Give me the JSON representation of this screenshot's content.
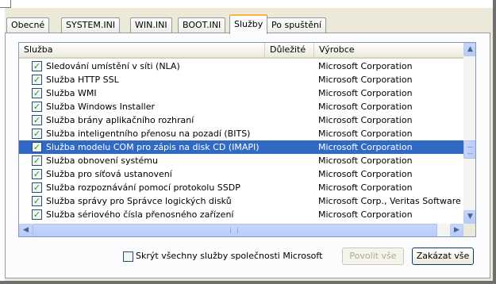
{
  "tabs": [
    "Obecné",
    "SYSTEM.INI",
    "WIN.INI",
    "BOOT.INI",
    "Služby",
    "Po spuštění"
  ],
  "active_tab": "Služby",
  "list": {
    "columns": {
      "service": "Služba",
      "essential": "Důležité",
      "manufacturer": "Výrobce"
    },
    "rows": [
      {
        "name": "Sledování umístění v síti (NLA)",
        "vendor": "Microsoft Corporation",
        "checked": true,
        "selected": false
      },
      {
        "name": "Služba HTTP SSL",
        "vendor": "Microsoft Corporation",
        "checked": true,
        "selected": false
      },
      {
        "name": "Služba WMI",
        "vendor": "Microsoft Corporation",
        "checked": true,
        "selected": false
      },
      {
        "name": "Služba Windows Installer",
        "vendor": "Microsoft Corporation",
        "checked": true,
        "selected": false
      },
      {
        "name": "Služba brány aplikačního rozhraní",
        "vendor": "Microsoft Corporation",
        "checked": true,
        "selected": false
      },
      {
        "name": "Služba inteligentního přenosu na pozadí (BITS)",
        "vendor": "Microsoft Corporation",
        "checked": true,
        "selected": false
      },
      {
        "name": "Služba modelu COM pro zápis na disk CD (IMAPI)",
        "vendor": "Microsoft Corporation",
        "checked": true,
        "selected": true
      },
      {
        "name": "Služba obnovení systému",
        "vendor": "Microsoft Corporation",
        "checked": true,
        "selected": false
      },
      {
        "name": "Služba pro síťová ustanovení",
        "vendor": "Microsoft Corporation",
        "checked": true,
        "selected": false
      },
      {
        "name": "Služba rozpoznávání pomocí protokolu SSDP",
        "vendor": "Microsoft Corporation",
        "checked": true,
        "selected": false
      },
      {
        "name": "Služba správy pro Správce logických disků",
        "vendor": "Microsoft Corp., Veritas Software",
        "checked": true,
        "selected": false
      },
      {
        "name": "Služba sériového čísla přenosného zařízení",
        "vendor": "Microsoft Corporation",
        "checked": true,
        "selected": false
      }
    ]
  },
  "hide_ms_label": "Skrýt všechny služby společnosti Microsoft",
  "hide_ms_checked": false,
  "buttons": {
    "enable_all": "Povolit vše",
    "disable_all": "Zakázat vše"
  },
  "icons": {
    "scroll_up": "▲",
    "scroll_down": "▼",
    "scroll_left": "◀",
    "scroll_right": "▶",
    "check": "✓"
  },
  "colors": {
    "selection": "#316ac5",
    "check": "#21a121",
    "tab_accent": "#f7b545"
  }
}
